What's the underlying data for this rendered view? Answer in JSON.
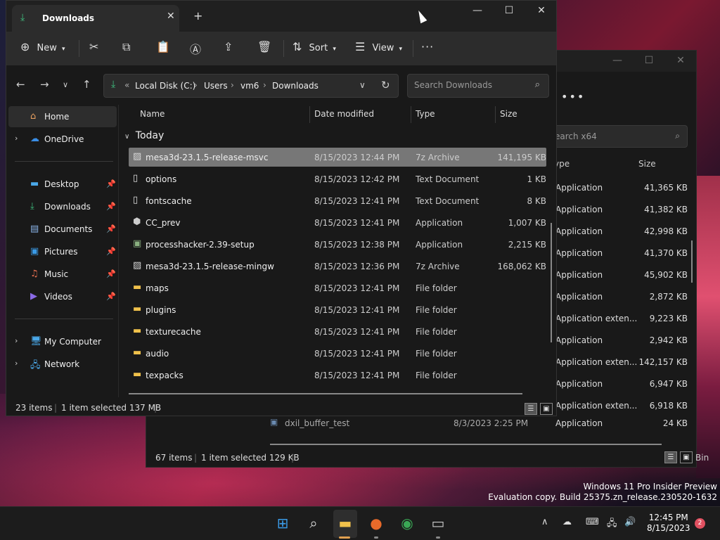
{
  "back_window": {
    "search_placeholder": "earch x64",
    "columns": {
      "type": "ype",
      "size": "Size"
    },
    "rows": [
      {
        "type": "Application",
        "size": "41,365 KB"
      },
      {
        "type": "Application",
        "size": "41,382 KB"
      },
      {
        "type": "Application",
        "size": "42,998 KB"
      },
      {
        "type": "Application",
        "size": "41,370 KB"
      },
      {
        "type": "Application",
        "size": "45,902 KB"
      },
      {
        "type": "Application",
        "size": "2,872 KB"
      },
      {
        "type": "Application exten...",
        "size": "9,223 KB"
      },
      {
        "type": "Application",
        "size": "2,942 KB"
      },
      {
        "type": "Application exten...",
        "size": "142,157 KB"
      },
      {
        "type": "Application",
        "size": "6,947 KB"
      },
      {
        "type": "Application exten...",
        "size": "6,918 KB"
      }
    ],
    "last_file": {
      "name": "dxil_buffer_test",
      "date": "8/3/2023 2:25 PM",
      "type": "Application",
      "size": "24 KB"
    },
    "status": {
      "count": "67 items",
      "selected": "1 item selected  129 KB"
    },
    "partial_text": "Bin"
  },
  "window": {
    "tab_title": "Downloads",
    "new_tab": "+",
    "toolbar": {
      "new_label": "New",
      "sort_label": "Sort",
      "view_label": "View",
      "more": "···"
    },
    "breadcrumb": {
      "prefix": "«",
      "items": [
        "Local Disk (C:)",
        "Users",
        "vm6",
        "Downloads"
      ]
    },
    "search_placeholder": "Search Downloads",
    "sidebar": {
      "home": "Home",
      "onedrive": "OneDrive",
      "quick": [
        "Desktop",
        "Downloads",
        "Documents",
        "Pictures",
        "Music",
        "Videos"
      ],
      "my_computer": "My Computer",
      "network": "Network"
    },
    "columns": {
      "name": "Name",
      "date": "Date modified",
      "type": "Type",
      "size": "Size"
    },
    "group": "Today",
    "files": [
      {
        "name": "mesa3d-23.1.5-release-msvc",
        "date": "8/15/2023 12:44 PM",
        "type": "7z Archive",
        "size": "141,195 KB",
        "icon": "archive-icon"
      },
      {
        "name": "options",
        "date": "8/15/2023 12:42 PM",
        "type": "Text Document",
        "size": "1 KB",
        "icon": "text-file-icon"
      },
      {
        "name": "fontscache",
        "date": "8/15/2023 12:41 PM",
        "type": "Text Document",
        "size": "8 KB",
        "icon": "text-file-icon"
      },
      {
        "name": "CC_prev",
        "date": "8/15/2023 12:41 PM",
        "type": "Application",
        "size": "1,007 KB",
        "icon": "app-icon"
      },
      {
        "name": "processhacker-2.39-setup",
        "date": "8/15/2023 12:38 PM",
        "type": "Application",
        "size": "2,215 KB",
        "icon": "installer-icon"
      },
      {
        "name": "mesa3d-23.1.5-release-mingw",
        "date": "8/15/2023 12:36 PM",
        "type": "7z Archive",
        "size": "168,062 KB",
        "icon": "archive-icon"
      },
      {
        "name": "maps",
        "date": "8/15/2023 12:41 PM",
        "type": "File folder",
        "size": "",
        "icon": "folder-icon"
      },
      {
        "name": "plugins",
        "date": "8/15/2023 12:41 PM",
        "type": "File folder",
        "size": "",
        "icon": "folder-icon"
      },
      {
        "name": "texturecache",
        "date": "8/15/2023 12:41 PM",
        "type": "File folder",
        "size": "",
        "icon": "folder-icon"
      },
      {
        "name": "audio",
        "date": "8/15/2023 12:41 PM",
        "type": "File folder",
        "size": "",
        "icon": "folder-icon"
      },
      {
        "name": "texpacks",
        "date": "8/15/2023 12:41 PM",
        "type": "File folder",
        "size": "",
        "icon": "folder-icon"
      }
    ],
    "status": {
      "count": "23 items",
      "selected": "1 item selected  137 MB"
    }
  },
  "watermark": {
    "line1": "Windows 11 Pro Insider Preview",
    "line2": "Evaluation copy. Build 25375.zn_release.230520-1632"
  },
  "taskbar": {
    "time": "12:45 PM",
    "date": "8/15/2023",
    "notifications": "2"
  },
  "colors": {
    "accent_green": "#3fbf7f",
    "folder": "#f0c14b",
    "selection": "#777777"
  }
}
